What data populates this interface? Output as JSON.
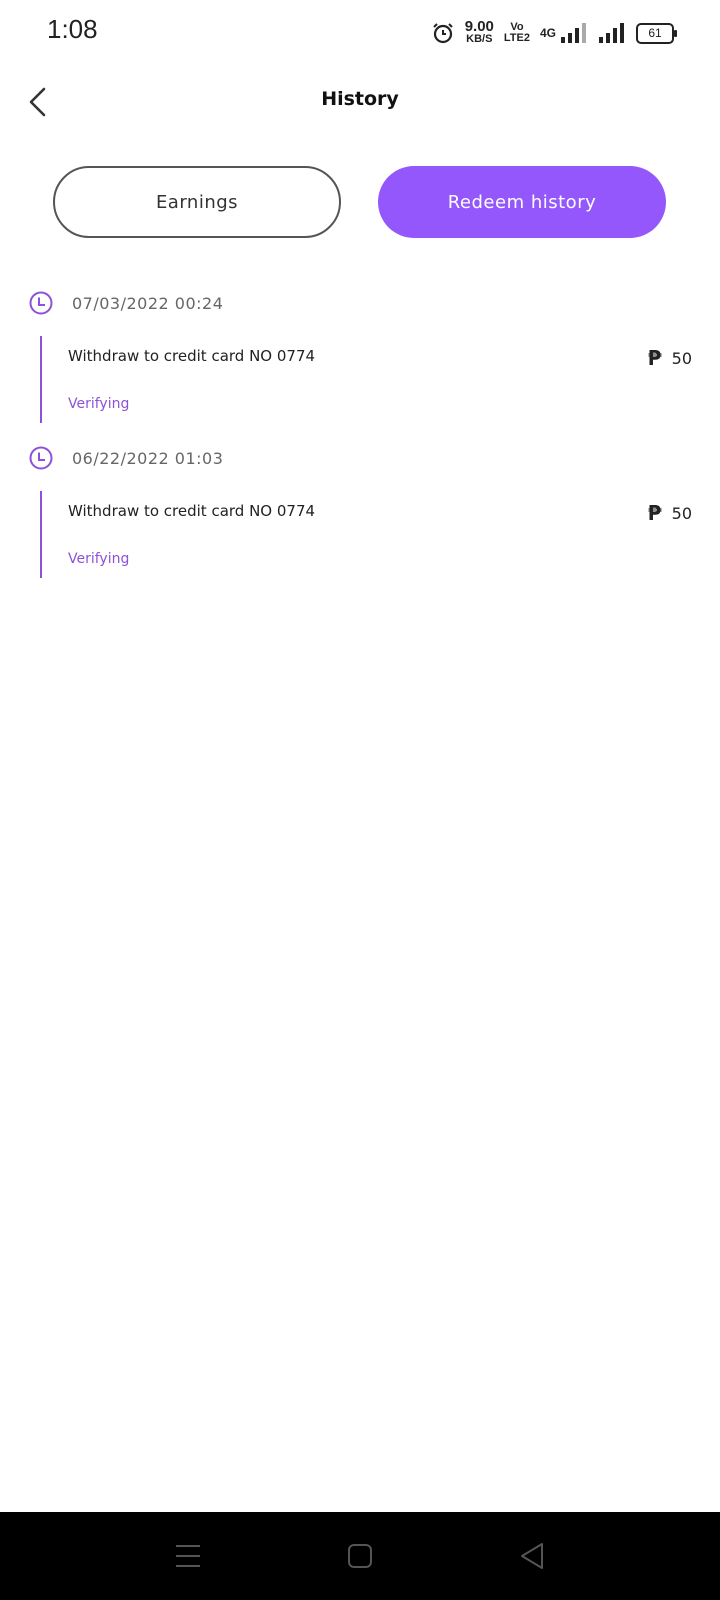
{
  "status_bar": {
    "time": "1:08",
    "speed_value": "9.00",
    "speed_unit": "KB/S",
    "volte_top": "Vo",
    "volte_bottom": "LTE2",
    "network": "4G",
    "battery": "61",
    "icons": [
      "alarm-icon",
      "signal-icon",
      "battery-icon"
    ]
  },
  "header": {
    "title": "History",
    "back_icon": "chevron-left-icon"
  },
  "tabs": [
    {
      "label": "Earnings",
      "active": false
    },
    {
      "label": "Redeem history",
      "active": true
    }
  ],
  "history": [
    {
      "date": "07/03/2022 00:24",
      "description": "Withdraw to credit card NO 0774",
      "currency_symbol": "₱",
      "amount": "50",
      "status": "Verifying"
    },
    {
      "date": "06/22/2022 01:03",
      "description": "Withdraw to credit card NO 0774",
      "currency_symbol": "₱",
      "amount": "50",
      "status": "Verifying"
    }
  ],
  "nav_bar": {
    "icons": [
      "menu-icon",
      "home-icon",
      "back-triangle-icon"
    ]
  },
  "colors": {
    "accent": "#9457fb",
    "timeline": "#8d52d8",
    "status_text": "#8d52d8",
    "nav_bar_bg": "#000000"
  }
}
